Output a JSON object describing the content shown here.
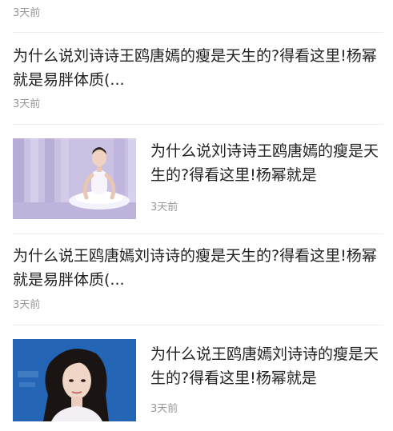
{
  "top_item": {
    "timestamp": "3天前"
  },
  "items": [
    {
      "title": "为什么说刘诗诗王鸥唐嫣的瘦是天生的?得看这里!杨幂就是易胖体质(...",
      "timestamp": "3天前",
      "has_image": false
    },
    {
      "title": "为什么说刘诗诗王鸥唐嫣的瘦是天生的?得看这里!杨幂就是",
      "timestamp": "3天前",
      "has_image": true,
      "image_icon": "ballerina-photo"
    },
    {
      "title": "为什么说王鸥唐嫣刘诗诗的瘦是天生的?得看这里!杨幂就是易胖体质(...",
      "timestamp": "3天前",
      "has_image": false
    },
    {
      "title": "为什么说王鸥唐嫣刘诗诗的瘦是天生的?得看这里!杨幂就是",
      "timestamp": "3天前",
      "has_image": true,
      "image_icon": "actress-portrait-photo"
    }
  ],
  "colors": {
    "timestamp": "#999999",
    "title": "#222222",
    "divider": "#ececec",
    "thumb1_bg": "#c9c0e2",
    "thumb2_bg": "#1f5fae"
  }
}
